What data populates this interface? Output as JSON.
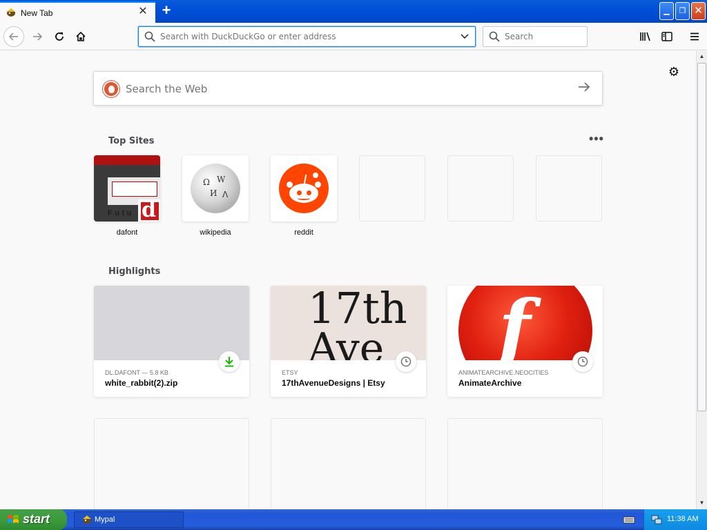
{
  "window": {
    "tab_title": "New Tab",
    "new_tab_symbol": "+",
    "close_tab_symbol": "✕",
    "min_symbol": "▁",
    "max_symbol": "❐",
    "close_symbol": "✕"
  },
  "toolbar": {
    "url_placeholder": "Search with DuckDuckGo or enter address",
    "search_placeholder": "Search",
    "back_icon": "arrow-left-icon",
    "forward_icon": "arrow-right-icon",
    "reload_icon": "reload-icon",
    "home_icon": "home-icon"
  },
  "newtab": {
    "web_search_placeholder": "Search the Web",
    "top_sites_title": "Top Sites",
    "highlights_title": "Highlights",
    "more_symbol": "•••",
    "top_sites": [
      {
        "label": "dafont"
      },
      {
        "label": "wikipedia"
      },
      {
        "label": "reddit"
      },
      {
        "label": ""
      },
      {
        "label": ""
      },
      {
        "label": ""
      }
    ],
    "highlights": [
      {
        "host": "DL.DAFONT — 5.8 KB",
        "title": "white_rabbit(2).zip",
        "badge": "download-icon"
      },
      {
        "host": "ETSY",
        "title": "17thAvenueDesigns | Etsy",
        "badge": "history-icon",
        "thumb_line1": "17th",
        "thumb_line2": "Ave"
      },
      {
        "host": "ANIMATEARCHIVE.NEOCITIES",
        "title": "AnimateArchive",
        "badge": "history-icon",
        "thumb_letter": "f"
      }
    ],
    "dafont_thumb_text": "Futu",
    "dafont_letter": "d"
  },
  "taskbar": {
    "start_label": "start",
    "task_label": "Mypal",
    "clock": "11:38 AM"
  },
  "colors": {
    "accent": "#0a84ff",
    "reddit": "#ff4500",
    "download_green": "#12bc00",
    "duckduckgo": "#de5833"
  }
}
